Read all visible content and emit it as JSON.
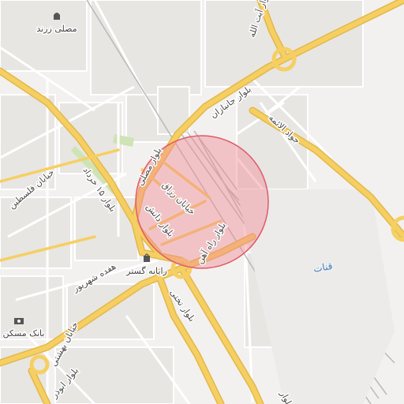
{
  "map": {
    "colors": {
      "background": "#f2f1ef",
      "block": "#e7e6e3",
      "minor_road": "#ffffff",
      "major_road": "#f6cf63",
      "major_road_casing": "#e3b84a",
      "rail": "#b9b9b9",
      "park": "#cfe3b4",
      "circle_fill": "#f28b94",
      "circle_stroke": "#e05a68"
    },
    "highlight_circle": {
      "shape": "circle",
      "fill_opacity": 0.45
    },
    "roads": {
      "top_right_boulevard": "بلوار آیت الله",
      "janbazan": "بلوار جانبازان",
      "javad_aemeh": "جواد الائمه",
      "mosalla": "بلوار مصلی",
      "khordad": "بلوار ۱۵ خرداد",
      "falastin": "خیابان فلسطین",
      "razagh": "خیابان رزاق",
      "daneshu": "بلوار دانش",
      "rahahan": "بلوار راه آهن",
      "hafdah_shahrivar": "هفده شهریور",
      "takhti": "بلوار تختی",
      "beheshti": "خیابان بهشتی",
      "bottom_left": "بلوار ابوذر",
      "bottom_right": "بلوار ..."
    },
    "pois": {
      "mosalla_zarand": {
        "label": "مصلی زرند",
        "icon": "mosque-icon"
      },
      "rayaneh_gostar": {
        "label": "رایانه گستر",
        "icon": "shopping-bag-icon"
      },
      "bank_maskan": {
        "label": "بانک مسکن",
        "icon": "bank-icon"
      }
    },
    "water_label": "قنات"
  }
}
